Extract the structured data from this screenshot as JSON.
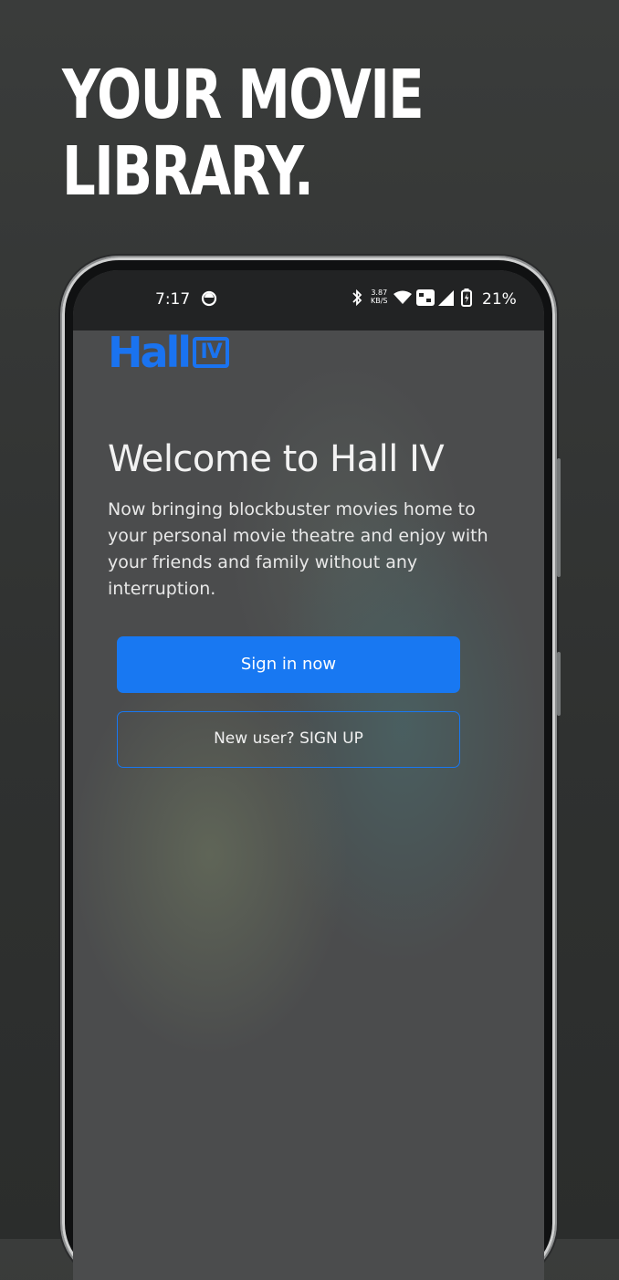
{
  "promo": {
    "headline_line1": "YOUR MOVIE",
    "headline_line2": "LIBRARY."
  },
  "status_bar": {
    "time": "7:17",
    "net_speed_value": "3.87",
    "net_speed_unit": "KB/S",
    "battery_percent": "21%",
    "icons": [
      "circle-notification-icon",
      "bluetooth-icon",
      "wifi-icon",
      "volte-icon",
      "signal-icon",
      "battery-charging-icon"
    ]
  },
  "app": {
    "logo_text": "Hall",
    "logo_badge": "IV",
    "welcome_title": "Welcome to Hall IV",
    "description": "Now bringing blockbuster movies home to your personal movie theatre and enjoy with your friends and family without any interruption.",
    "sign_in_label": "Sign in now",
    "sign_up_label": "New user? SIGN UP"
  },
  "colors": {
    "accent": "#1878f2",
    "logo": "#1a73f0",
    "background": "#333534",
    "screen": "#4b4c4d"
  }
}
